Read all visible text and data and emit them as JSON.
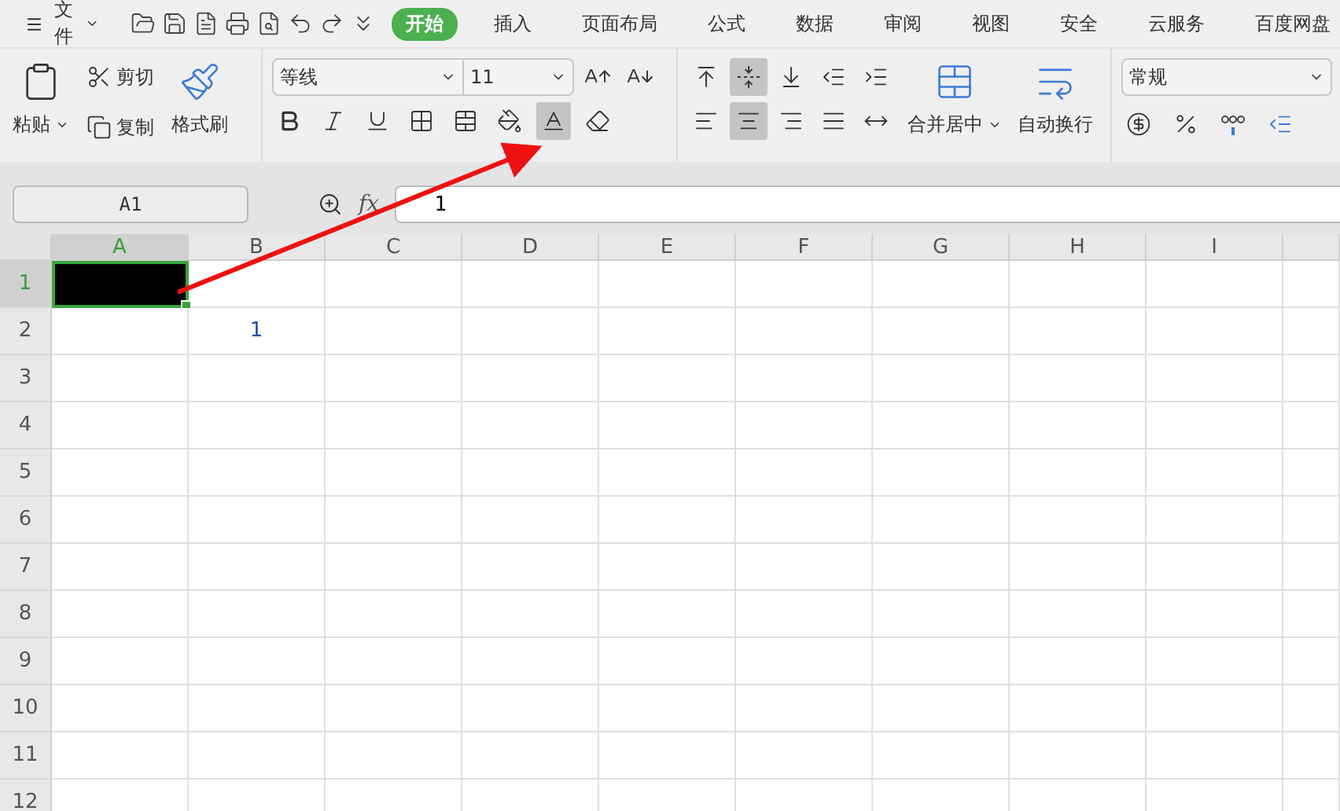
{
  "menu": {
    "label": "文件"
  },
  "tabs": [
    {
      "label": "开始",
      "selected": true
    },
    {
      "label": "插入",
      "selected": false
    },
    {
      "label": "页面布局",
      "selected": false
    },
    {
      "label": "公式",
      "selected": false
    },
    {
      "label": "数据",
      "selected": false
    },
    {
      "label": "审阅",
      "selected": false
    },
    {
      "label": "视图",
      "selected": false
    },
    {
      "label": "安全",
      "selected": false
    },
    {
      "label": "云服务",
      "selected": false
    },
    {
      "label": "百度网盘",
      "selected": false
    }
  ],
  "clipboard": {
    "paste": "粘贴",
    "cut": "剪切",
    "copy": "复制",
    "format_painter": "格式刷"
  },
  "font": {
    "name": "等线",
    "size": "11",
    "font_color_highlighted": true
  },
  "alignment": {
    "vertical": [
      {
        "kind": "top",
        "selected": false
      },
      {
        "kind": "middle",
        "selected": true
      },
      {
        "kind": "bottom",
        "selected": false
      },
      {
        "kind": "outdent",
        "selected": false
      },
      {
        "kind": "indent",
        "selected": false
      }
    ],
    "horizontal": [
      {
        "kind": "left",
        "selected": false
      },
      {
        "kind": "center",
        "selected": true
      },
      {
        "kind": "right",
        "selected": false
      },
      {
        "kind": "justify",
        "selected": false
      },
      {
        "kind": "distributed",
        "selected": false
      }
    ],
    "merge": "合并居中",
    "wrap": "自动换行"
  },
  "number": {
    "format": "常规"
  },
  "formula_bar": {
    "name_box": "A1",
    "fx": "fx",
    "formula": "1"
  },
  "sheet": {
    "columns": [
      {
        "label": "A",
        "selected": true
      },
      {
        "label": "B",
        "selected": false
      },
      {
        "label": "C",
        "selected": false
      },
      {
        "label": "D",
        "selected": false
      },
      {
        "label": "E",
        "selected": false
      },
      {
        "label": "F",
        "selected": false
      },
      {
        "label": "G",
        "selected": false
      },
      {
        "label": "H",
        "selected": false
      },
      {
        "label": "I",
        "selected": false
      }
    ],
    "rows": [
      {
        "label": "1",
        "selected": true,
        "cells": [
          {
            "selected": true,
            "color": "#000000"
          }
        ]
      },
      {
        "label": "2",
        "selected": false,
        "cells": [
          {
            "selected": false
          },
          {
            "selected": false,
            "value": "1"
          }
        ]
      },
      {
        "label": "3",
        "selected": false
      },
      {
        "label": "4",
        "selected": false
      },
      {
        "label": "5",
        "selected": false
      },
      {
        "label": "6",
        "selected": false
      },
      {
        "label": "7",
        "selected": false
      },
      {
        "label": "8",
        "selected": false
      },
      {
        "label": "9",
        "selected": false
      },
      {
        "label": "10",
        "selected": false
      },
      {
        "label": "11",
        "selected": false
      },
      {
        "label": "12",
        "selected": false
      }
    ]
  }
}
